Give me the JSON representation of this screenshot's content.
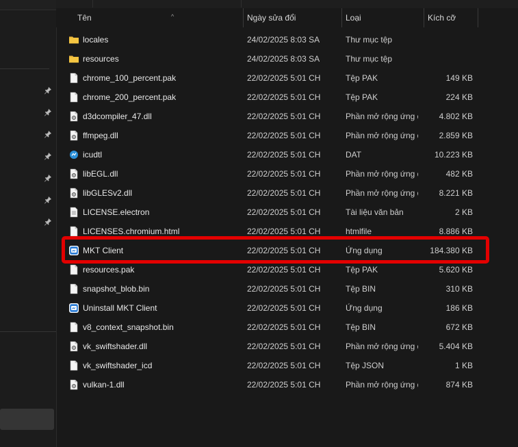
{
  "header": {
    "col_name": "Tên",
    "col_date": "Ngày sửa đổi",
    "col_type": "Loại",
    "col_size": "Kích cỡ",
    "sort_indicator": "^"
  },
  "files": [
    {
      "name": "locales",
      "date": "24/02/2025 8:03 SA",
      "type": "Thư mục tệp",
      "size": "",
      "icon": "folder-icon"
    },
    {
      "name": "resources",
      "date": "24/02/2025 8:03 SA",
      "type": "Thư mục tệp",
      "size": "",
      "icon": "folder-icon"
    },
    {
      "name": "chrome_100_percent.pak",
      "date": "22/02/2025 5:01 CH",
      "type": "Tệp PAK",
      "size": "149 KB",
      "icon": "file-icon"
    },
    {
      "name": "chrome_200_percent.pak",
      "date": "22/02/2025 5:01 CH",
      "type": "Tệp PAK",
      "size": "224 KB",
      "icon": "file-icon"
    },
    {
      "name": "d3dcompiler_47.dll",
      "date": "22/02/2025 5:01 CH",
      "type": "Phần mở rộng ứng dụng",
      "size": "4.802 KB",
      "icon": "dll-icon"
    },
    {
      "name": "ffmpeg.dll",
      "date": "22/02/2025 5:01 CH",
      "type": "Phần mở rộng ứng dụng",
      "size": "2.859 KB",
      "icon": "dll-icon"
    },
    {
      "name": "icudtl",
      "date": "22/02/2025 5:01 CH",
      "type": "DAT",
      "size": "10.223 KB",
      "icon": "data-icon"
    },
    {
      "name": "libEGL.dll",
      "date": "22/02/2025 5:01 CH",
      "type": "Phần mở rộng ứng dụng",
      "size": "482 KB",
      "icon": "dll-icon"
    },
    {
      "name": "libGLESv2.dll",
      "date": "22/02/2025 5:01 CH",
      "type": "Phần mở rộng ứng dụng",
      "size": "8.221 KB",
      "icon": "dll-icon"
    },
    {
      "name": "LICENSE.electron",
      "date": "22/02/2025 5:01 CH",
      "type": "Tài liệu văn bản",
      "size": "2 KB",
      "icon": "text-file-icon"
    },
    {
      "name": "LICENSES.chromium.html",
      "date": "22/02/2025 5:01 CH",
      "type": "htmlfile",
      "size": "8.886 KB",
      "icon": "file-icon"
    },
    {
      "name": "MKT Client",
      "date": "22/02/2025 5:01 CH",
      "type": "Ứng dụng",
      "size": "184.380 KB",
      "icon": "app-icon"
    },
    {
      "name": "resources.pak",
      "date": "22/02/2025 5:01 CH",
      "type": "Tệp PAK",
      "size": "5.620 KB",
      "icon": "file-icon"
    },
    {
      "name": "snapshot_blob.bin",
      "date": "22/02/2025 5:01 CH",
      "type": "Tệp BIN",
      "size": "310 KB",
      "icon": "file-icon"
    },
    {
      "name": "Uninstall MKT Client",
      "date": "22/02/2025 5:01 CH",
      "type": "Ứng dụng",
      "size": "186 KB",
      "icon": "app-icon"
    },
    {
      "name": "v8_context_snapshot.bin",
      "date": "22/02/2025 5:01 CH",
      "type": "Tệp BIN",
      "size": "672 KB",
      "icon": "file-icon"
    },
    {
      "name": "vk_swiftshader.dll",
      "date": "22/02/2025 5:01 CH",
      "type": "Phần mở rộng ứng dụng",
      "size": "5.404 KB",
      "icon": "dll-icon"
    },
    {
      "name": "vk_swiftshader_icd",
      "date": "22/02/2025 5:01 CH",
      "type": "Tệp JSON",
      "size": "1 KB",
      "icon": "file-icon"
    },
    {
      "name": "vulkan-1.dll",
      "date": "22/02/2025 5:01 CH",
      "type": "Phần mở rộng ứng dụng",
      "size": "874 KB",
      "icon": "dll-icon"
    }
  ],
  "colors": {
    "highlight": "#e30000",
    "folder": "#f5c642",
    "app_blue": "#2a7bd4"
  }
}
